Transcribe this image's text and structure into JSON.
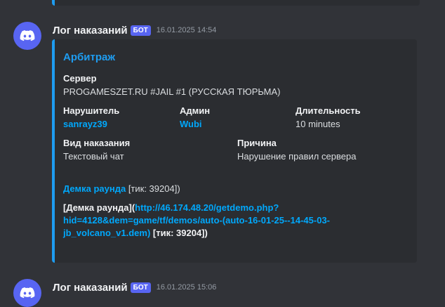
{
  "message": {
    "username": "Лог наказаний",
    "badge": "БОТ",
    "timestamp": "16.01.2025 14:54",
    "embed": {
      "title": "Арбитраж",
      "server_label": "Сервер",
      "server_value": "PROGAMESZET.RU #JAIL #1 (РУССКАЯ ТЮРЬМА)",
      "violator_label": "Нарушитель",
      "violator_value": "sanrayz39",
      "admin_label": "Админ",
      "admin_value": "Wubi",
      "duration_label": "Длительность",
      "duration_value": "10 minutes",
      "punishment_label": "Вид наказания",
      "punishment_value": "Текстовый чат",
      "reason_label": "Причина",
      "reason_value": "Нарушение правил сервера",
      "demo_link": "Демка раунда",
      "demo_tick": "[тик: 39204])",
      "demo_md_open": "[Демка раунда](",
      "demo_url": "http://46.174.48.20/getdemo.php?hid=4128&dem=game/tf/demos/auto-(auto-16-01-25--14-45-03-jb_volcano_v1.dem)",
      "demo_md_close": " [тик: 39204])"
    }
  },
  "next_message": {
    "username": "Лог наказаний",
    "badge": "БОТ",
    "timestamp": "16.01.2025 15:06"
  },
  "colors": {
    "background": "#313338",
    "embed_bg": "#2b2d31",
    "embed_accent": "#1e9cf0",
    "link": "#00a8fc",
    "bot_badge": "#5865f2"
  }
}
